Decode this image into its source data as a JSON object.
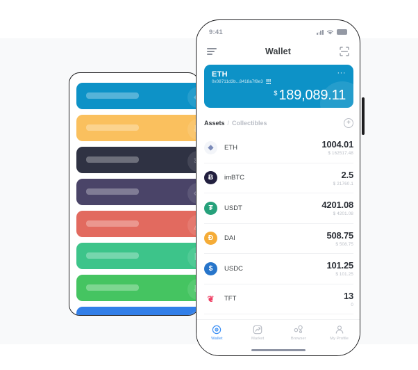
{
  "theme": {
    "page_bg": "#ffffff",
    "band_bg": "#f8f9fa",
    "frame": "#1d1d1f",
    "accent_blue": "#0d92c7",
    "tab_active": "#3b8ff5",
    "text_dark": "#2b2f36",
    "text_muted": "#b9bdc5"
  },
  "left_panel": {
    "name": "card-stack-panel",
    "cards": [
      {
        "color": "#0d92c7",
        "glyph": "◆",
        "token": "ethereum"
      },
      {
        "color": "#fac05e",
        "glyph": "Ƀ",
        "token": "bitcoin"
      },
      {
        "color": "#2f3243",
        "glyph": "⚛",
        "token": "cosmos"
      },
      {
        "color": "#4a4468",
        "glyph": "◇",
        "token": "eos"
      },
      {
        "color": "#e26a5f",
        "glyph": "△",
        "token": "tron"
      },
      {
        "color": "#3dc48a",
        "glyph": "N",
        "token": "neo"
      },
      {
        "color": "#45c461",
        "glyph": "Ƀ",
        "token": "bitcoin-cash"
      },
      {
        "color": "#327fe8",
        "glyph": "Ł",
        "token": "litecoin"
      }
    ]
  },
  "phone": {
    "status_bar": {
      "time": "9:41",
      "signal_icon": "signal-bars-icon",
      "wifi_icon": "wifi-icon",
      "battery_icon": "battery-icon"
    },
    "header": {
      "menu_icon": "hamburger-menu-icon",
      "title": "Wallet",
      "scan_icon": "scan-qr-icon"
    },
    "balance_card": {
      "symbol": "ETH",
      "address": "0x08711d3b...8418a7f8e3",
      "qr_icon": "qr-code-icon",
      "more_icon": "more-options-icon",
      "more_label": "···",
      "currency": "$",
      "amount": "189,089.11",
      "bg_color": "#0d92c7"
    },
    "asset_tabs": {
      "assets_label": "Assets",
      "separator": "/",
      "collectibles_label": "Collectibles",
      "add_icon": "add-asset-icon",
      "add_label": "+"
    },
    "assets": [
      {
        "symbol": "ETH",
        "amount": "1004.01",
        "fiat": "$ 162517.48",
        "icon_bg": "#f3f5f9",
        "icon_fg": "#7b8ab8",
        "icon_glyph": "◆"
      },
      {
        "symbol": "imBTC",
        "amount": "2.5",
        "fiat": "$ 21760.1",
        "icon_bg": "#22203f",
        "icon_fg": "#ffffff",
        "icon_glyph": "Ƀ"
      },
      {
        "symbol": "USDT",
        "amount": "4201.08",
        "fiat": "$ 4201.08",
        "icon_bg": "#26a17b",
        "icon_fg": "#ffffff",
        "icon_glyph": "₮"
      },
      {
        "symbol": "DAI",
        "amount": "508.75",
        "fiat": "$ 508.75",
        "icon_bg": "#f5ac37",
        "icon_fg": "#ffffff",
        "icon_glyph": "Đ"
      },
      {
        "symbol": "USDC",
        "amount": "101.25",
        "fiat": "$ 101.25",
        "icon_bg": "#2775ca",
        "icon_fg": "#ffffff",
        "icon_glyph": "$"
      },
      {
        "symbol": "TFT",
        "amount": "13",
        "fiat": "0",
        "icon_bg": "#ffffff",
        "icon_fg": "#ef3e63",
        "icon_glyph": "❦"
      }
    ],
    "tab_bar": [
      {
        "label": "Wallet",
        "icon": "wallet-target-icon",
        "active": true
      },
      {
        "label": "Market",
        "icon": "market-chart-icon",
        "active": false
      },
      {
        "label": "Browser",
        "icon": "browser-nodes-icon",
        "active": false
      },
      {
        "label": "My Profile",
        "icon": "profile-person-icon",
        "active": false
      }
    ]
  }
}
